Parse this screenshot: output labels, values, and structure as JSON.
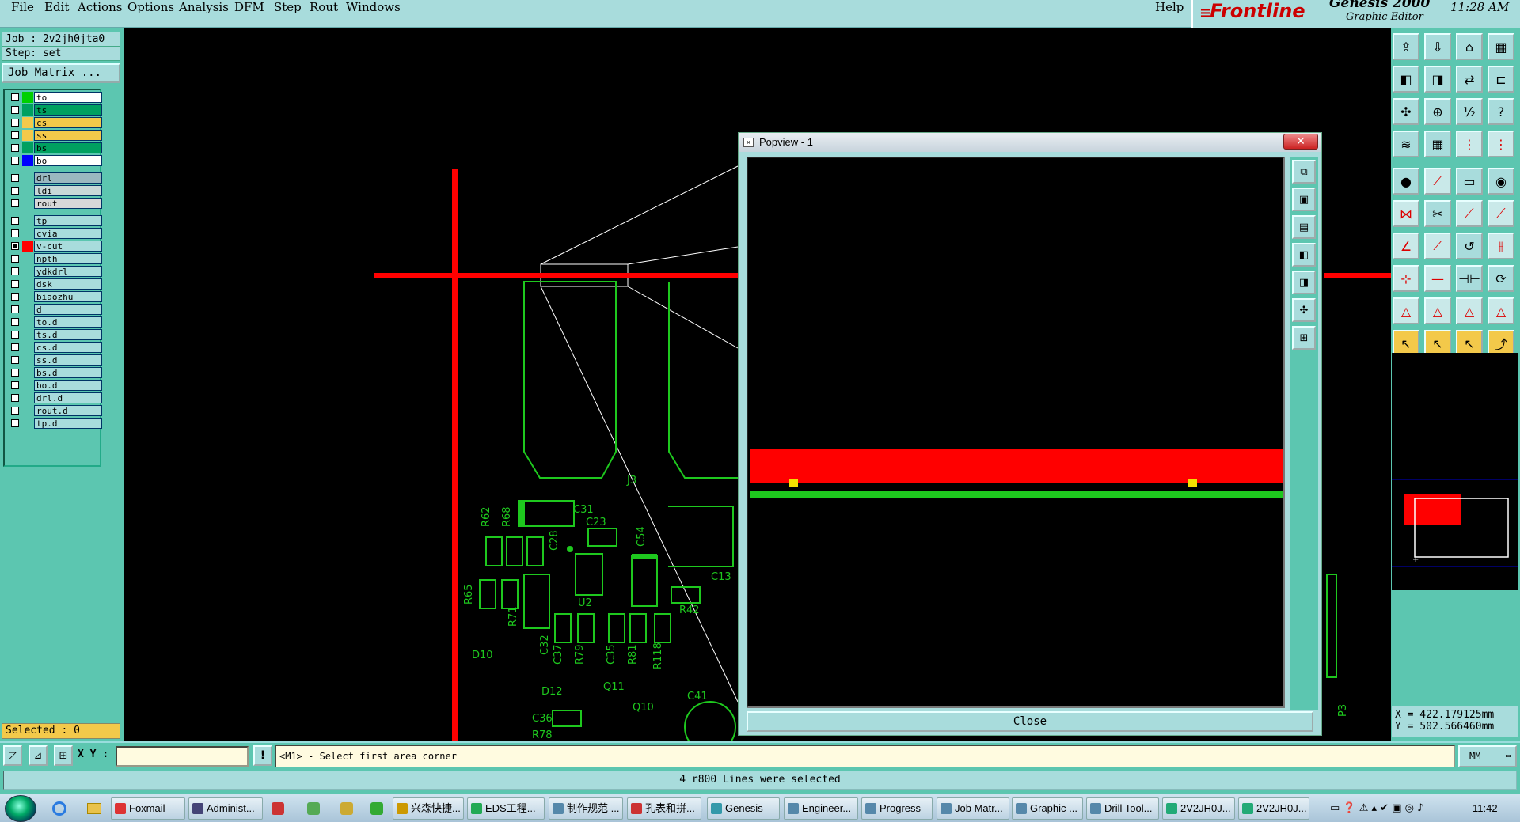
{
  "menubar": {
    "items": [
      "File",
      "Edit",
      "Actions",
      "Options",
      "Analysis",
      "DFM",
      "Step",
      "Rout",
      "Windows"
    ],
    "help": "Help"
  },
  "logo": {
    "brand": "Frontline",
    "product": "Genesis 2000",
    "subtitle": "Graphic Editor",
    "time": "11:28 AM"
  },
  "left_panel": {
    "job": "Job : 2v2jh0jta0",
    "step": "Step: set",
    "job_matrix_button": "Job Matrix ...",
    "layers": [
      {
        "name": "to",
        "swatch": "#00d000",
        "bg": "#ffffff",
        "checked": false
      },
      {
        "name": "ts",
        "swatch": "#00a060",
        "bg": "#00a060",
        "checked": false
      },
      {
        "name": "cs",
        "swatch": "#f3c94a",
        "bg": "#f3c94a",
        "checked": false
      },
      {
        "name": "ss",
        "swatch": "#f3c94a",
        "bg": "#f3c94a",
        "checked": false
      },
      {
        "name": "bs",
        "swatch": "#00a060",
        "bg": "#00a060",
        "checked": false
      },
      {
        "name": "bo",
        "swatch": "#0000ff",
        "bg": "#ffffff",
        "checked": false
      },
      {
        "name": "drl",
        "swatch": "#5cc6b0",
        "bg": "#9ab8c0",
        "checked": false
      },
      {
        "name": "ldi",
        "swatch": "#5cc6b0",
        "bg": "#c8d8d8",
        "checked": false
      },
      {
        "name": "rout",
        "swatch": "#5cc6b0",
        "bg": "#d8d8d8",
        "checked": false
      },
      {
        "name": "tp",
        "swatch": "#5cc6b0",
        "bg": "#a8dcdc",
        "checked": false
      },
      {
        "name": "cvia",
        "swatch": "#5cc6b0",
        "bg": "#a8dcdc",
        "checked": false
      },
      {
        "name": "v-cut",
        "swatch": "#ff0000",
        "bg": "#a8dcdc",
        "checked": true
      },
      {
        "name": "npth",
        "swatch": "#5cc6b0",
        "bg": "#a8dcdc",
        "checked": false
      },
      {
        "name": "ydkdrl",
        "swatch": "#5cc6b0",
        "bg": "#a8dcdc",
        "checked": false
      },
      {
        "name": "dsk",
        "swatch": "#5cc6b0",
        "bg": "#a8dcdc",
        "checked": false
      },
      {
        "name": "biaozhu",
        "swatch": "#5cc6b0",
        "bg": "#a8dcdc",
        "checked": false
      },
      {
        "name": "d",
        "swatch": "#5cc6b0",
        "bg": "#a8dcdc",
        "checked": false
      },
      {
        "name": "to.d",
        "swatch": "#5cc6b0",
        "bg": "#a8dcdc",
        "checked": false
      },
      {
        "name": "ts.d",
        "swatch": "#5cc6b0",
        "bg": "#a8dcdc",
        "checked": false
      },
      {
        "name": "cs.d",
        "swatch": "#5cc6b0",
        "bg": "#a8dcdc",
        "checked": false
      },
      {
        "name": "ss.d",
        "swatch": "#5cc6b0",
        "bg": "#a8dcdc",
        "checked": false
      },
      {
        "name": "bs.d",
        "swatch": "#5cc6b0",
        "bg": "#a8dcdc",
        "checked": false
      },
      {
        "name": "bo.d",
        "swatch": "#5cc6b0",
        "bg": "#a8dcdc",
        "checked": false
      },
      {
        "name": "drl.d",
        "swatch": "#5cc6b0",
        "bg": "#a8dcdc",
        "checked": false
      },
      {
        "name": "rout.d",
        "swatch": "#5cc6b0",
        "bg": "#a8dcdc",
        "checked": false
      },
      {
        "name": "tp.d",
        "swatch": "#5cc6b0",
        "bg": "#a8dcdc",
        "checked": false
      }
    ],
    "selected": "Selected : 0"
  },
  "canvas": {
    "labels": [
      "J3",
      "C31",
      "C23",
      "R62",
      "R68",
      "C28",
      "C54",
      "R65",
      "R71",
      "C13",
      "U2",
      "R42",
      "C32",
      "C37",
      "R79",
      "C35",
      "R81",
      "R118",
      "D10",
      "D12",
      "Q11",
      "Q10",
      "C41",
      "C36",
      "R78",
      "P3"
    ]
  },
  "popview": {
    "title": "Popview - 1",
    "close_button": "Close"
  },
  "right_panel": {
    "coord_x": "X = 422.179125mm",
    "coord_y": "Y = 502.566460mm"
  },
  "command_bar": {
    "xy_label": "X Y :",
    "xy_value": "",
    "prompt": "<M1> - Select first area corner",
    "units": "MM"
  },
  "status": "4 r800 Lines were selected",
  "taskbar": {
    "clock": "11:42",
    "tasks": [
      "Foxmail",
      "Administ...",
      "兴森快捷...",
      "EDS工程...",
      "制作规范 ...",
      "孔表和拼...",
      "Genesis",
      "Engineer...",
      "Progress",
      "Job Matr...",
      "Graphic ...",
      "Drill Tool...",
      "2V2JH0J...",
      "2V2JH0J..."
    ]
  }
}
